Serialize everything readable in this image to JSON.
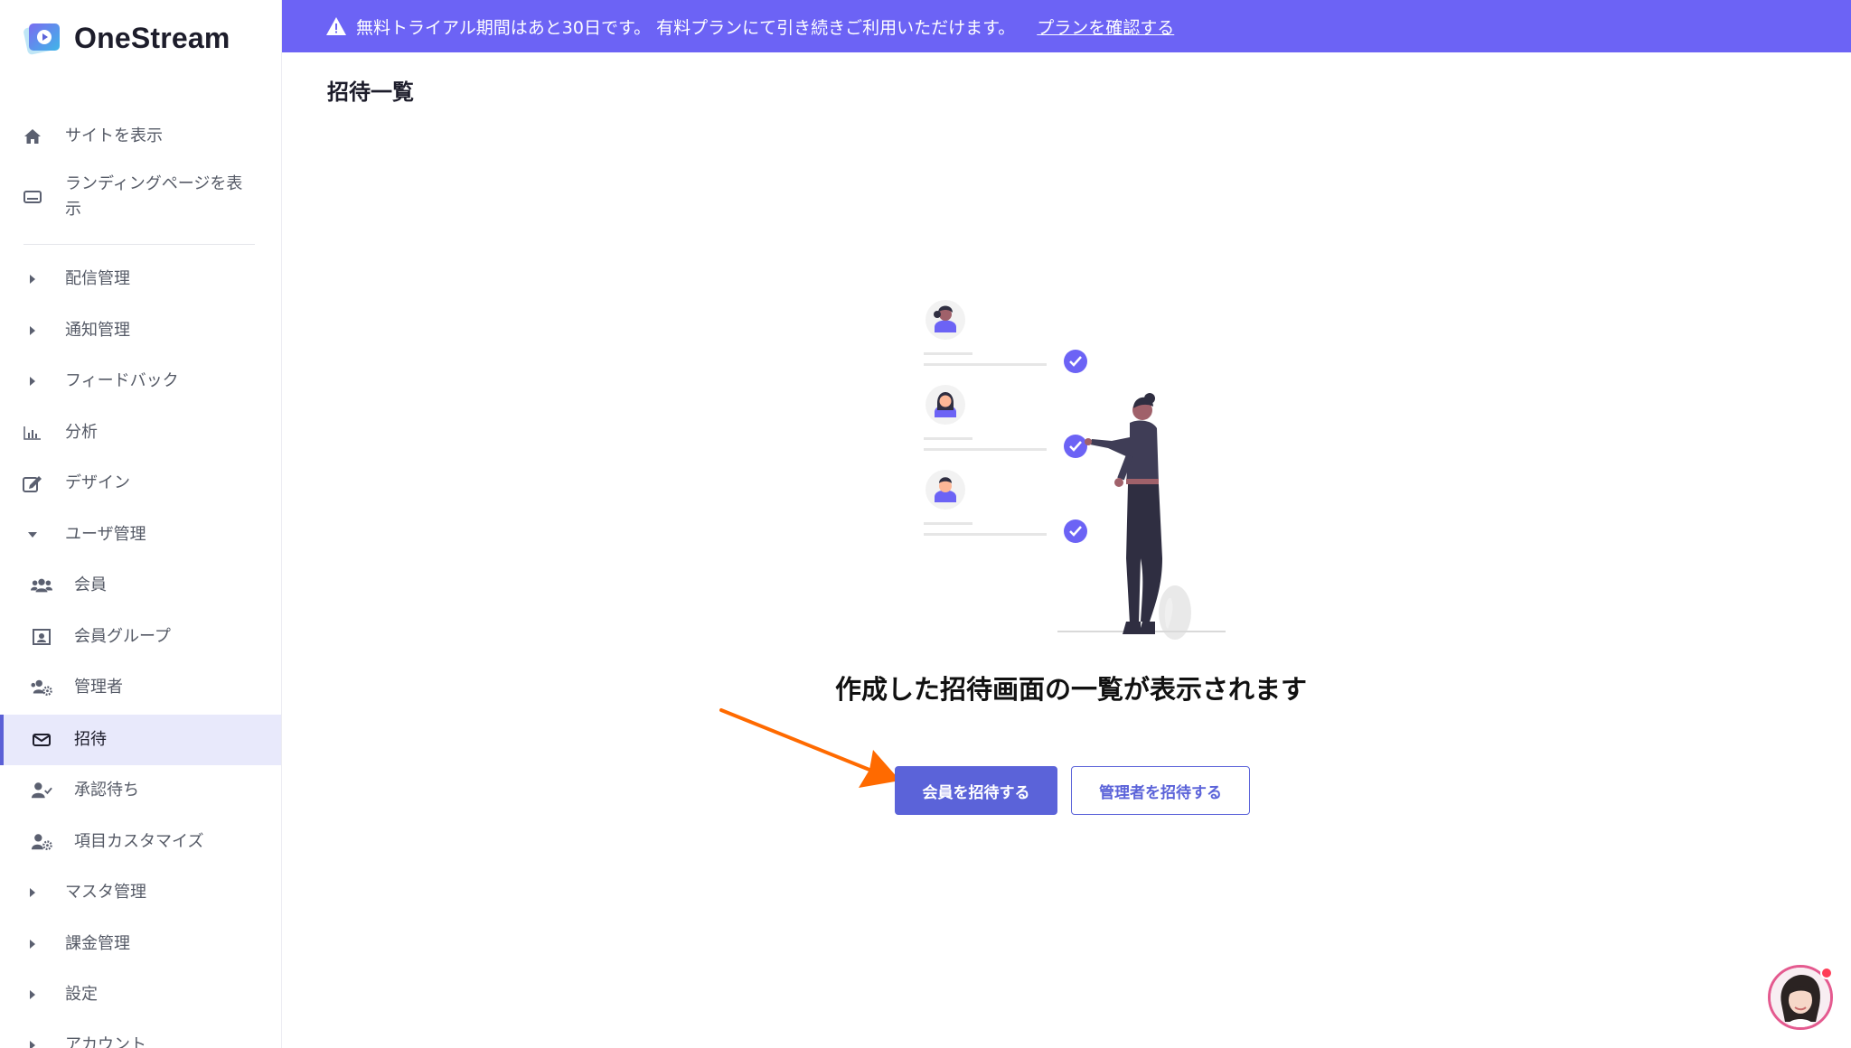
{
  "app": {
    "name": "OneStream",
    "logo_icon": "play-square-icon"
  },
  "banner": {
    "message": "無料トライアル期間はあと30日です。 有料プランにて引き続きご利用いただけます。",
    "link": "プランを確認する",
    "icon": "warning-icon",
    "color": "#6c63f5"
  },
  "sidebar": {
    "items": [
      {
        "label": "サイトを表示",
        "icon": "home-icon"
      },
      {
        "label": "ランディングページを表示",
        "label_line1": "ランディングページを表",
        "label_line2": "示",
        "icon": "display-icon"
      },
      {
        "label": "配信管理",
        "icon": "caret-right-icon"
      },
      {
        "label": "通知管理",
        "icon": "caret-right-icon"
      },
      {
        "label": "フィードバック",
        "icon": "caret-right-icon"
      },
      {
        "label": "分析",
        "icon": "bar-chart-icon"
      },
      {
        "label": "デザイン",
        "icon": "edit-icon"
      },
      {
        "label": "ユーザ管理",
        "icon": "caret-down-icon"
      },
      {
        "label": "会員",
        "icon": "users-icon"
      },
      {
        "label": "会員グループ",
        "icon": "group-box-icon"
      },
      {
        "label": "管理者",
        "icon": "users-cog-icon"
      },
      {
        "label": "招待",
        "icon": "envelope-icon",
        "active": true
      },
      {
        "label": "承認待ち",
        "icon": "user-check-icon"
      },
      {
        "label": "項目カスタマイズ",
        "icon": "user-cog-icon"
      },
      {
        "label": "マスタ管理",
        "icon": "caret-right-icon"
      },
      {
        "label": "課金管理",
        "icon": "caret-right-icon"
      },
      {
        "label": "設定",
        "icon": "caret-right-icon"
      },
      {
        "label": "アカウント",
        "icon": "caret-right-icon"
      }
    ]
  },
  "main": {
    "page_title": "招待一覧",
    "empty_message": "作成した招待画面の一覧が表示されます",
    "invite_member_button": "会員を招待する",
    "invite_admin_button": "管理者を招待する"
  },
  "colors": {
    "accent": "#5b63d9",
    "annotation_arrow": "#ff6a00"
  }
}
